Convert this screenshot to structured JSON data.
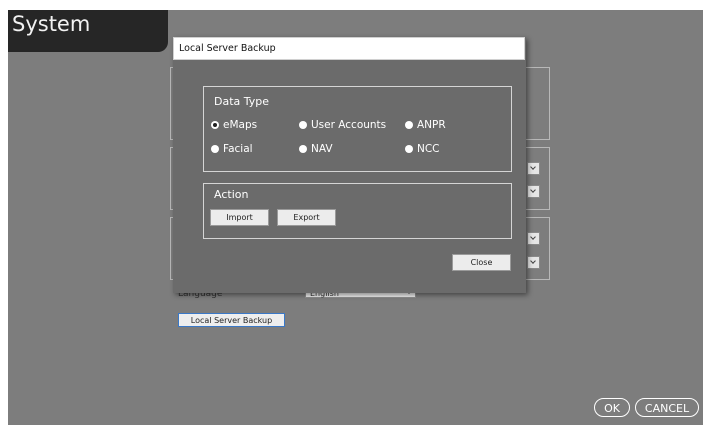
{
  "app": {
    "title": "System",
    "language_label": "Language",
    "language_value": "English",
    "local_server_backup_button": "Local Server Backup",
    "ok_label": "OK",
    "cancel_label": "CANCEL"
  },
  "dialog": {
    "title": "Local Server Backup",
    "data_type": {
      "title": "Data Type",
      "options": [
        {
          "label": "eMaps",
          "selected": true
        },
        {
          "label": "User Accounts",
          "selected": false
        },
        {
          "label": "ANPR",
          "selected": false
        },
        {
          "label": "Facial",
          "selected": false
        },
        {
          "label": "NAV",
          "selected": false
        },
        {
          "label": "NCC",
          "selected": false
        }
      ]
    },
    "action": {
      "title": "Action",
      "import_label": "Import",
      "export_label": "Export"
    },
    "close_label": "Close"
  },
  "colors": {
    "background": "#7d7d7d",
    "dialog_background": "#6b6b6b",
    "title_tab": "#262626",
    "focus_border": "#3a78c7"
  }
}
